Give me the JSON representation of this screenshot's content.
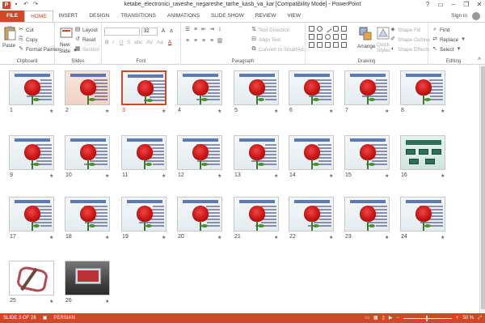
{
  "window": {
    "title": "ketabe_electronici_raveshe_negareshe_tarhe_kasb_va_kar [Compatibility Mode] - PowerPoint",
    "app_icon_label": "P"
  },
  "qat": {
    "save_icon": "save-icon",
    "undo_icon": "undo-icon",
    "redo_icon": "redo-icon"
  },
  "tabs": [
    "FILE",
    "HOME",
    "INSERT",
    "DESIGN",
    "TRANSITIONS",
    "ANIMATIONS",
    "SLIDE SHOW",
    "REVIEW",
    "VIEW"
  ],
  "active_tab": "HOME",
  "account": {
    "signin": "Sign in"
  },
  "ribbon": {
    "clipboard": {
      "paste": "Paste",
      "cut": "Cut",
      "copy": "Copy",
      "format_painter": "Format Painter",
      "label": "Clipboard"
    },
    "slides": {
      "new_slide_1": "New",
      "new_slide_2": "Slide",
      "layout": "Layout",
      "reset": "Reset",
      "section": "Section",
      "label": "Slides"
    },
    "font": {
      "size": "32",
      "label": "Font",
      "bold": "B",
      "italic": "I",
      "underline": "U",
      "strike": "S",
      "shadow": "abc",
      "spacing": "AV",
      "case": "Aa",
      "color": "A"
    },
    "paragraph": {
      "text_direction": "Text Direction",
      "align_text": "Align Text",
      "convert_smartart": "Convert to SmartArt",
      "label": "Paragraph"
    },
    "drawing": {
      "arrange": "Arrange",
      "quick_styles_1": "Quick",
      "quick_styles_2": "Styles",
      "shape_fill": "Shape Fill",
      "shape_outline": "Shape Outline",
      "shape_effects": "Shape Effects",
      "label": "Drawing"
    },
    "editing": {
      "find": "Find",
      "replace": "Replace",
      "select": "Select",
      "label": "Editing"
    }
  },
  "slides": [
    {
      "num": "1",
      "style": "rose"
    },
    {
      "num": "2",
      "style": "pink"
    },
    {
      "num": "3",
      "style": "rose-selected"
    },
    {
      "num": "4",
      "style": "rose"
    },
    {
      "num": "5",
      "style": "rose"
    },
    {
      "num": "6",
      "style": "rose"
    },
    {
      "num": "7",
      "style": "rose"
    },
    {
      "num": "8",
      "style": "rose"
    },
    {
      "num": "9",
      "style": "rose"
    },
    {
      "num": "10",
      "style": "rose"
    },
    {
      "num": "11",
      "style": "rose"
    },
    {
      "num": "12",
      "style": "rose"
    },
    {
      "num": "13",
      "style": "rose"
    },
    {
      "num": "14",
      "style": "rose"
    },
    {
      "num": "15",
      "style": "rose"
    },
    {
      "num": "16",
      "style": "boxes"
    },
    {
      "num": "17",
      "style": "rose"
    },
    {
      "num": "18",
      "style": "rose"
    },
    {
      "num": "19",
      "style": "rose"
    },
    {
      "num": "20",
      "style": "rose"
    },
    {
      "num": "21",
      "style": "rose"
    },
    {
      "num": "22",
      "style": "rose"
    },
    {
      "num": "23",
      "style": "rose"
    },
    {
      "num": "24",
      "style": "rose"
    },
    {
      "num": "25",
      "style": "ornament"
    },
    {
      "num": "26",
      "style": "photo"
    }
  ],
  "selected_slide": "3",
  "transition_marker": "★",
  "status": {
    "slide_info": "SLIDE 3 OF 26",
    "language": "PERSIAN",
    "zoom": "50 %",
    "zoom_out": "−",
    "zoom_in": "+"
  }
}
